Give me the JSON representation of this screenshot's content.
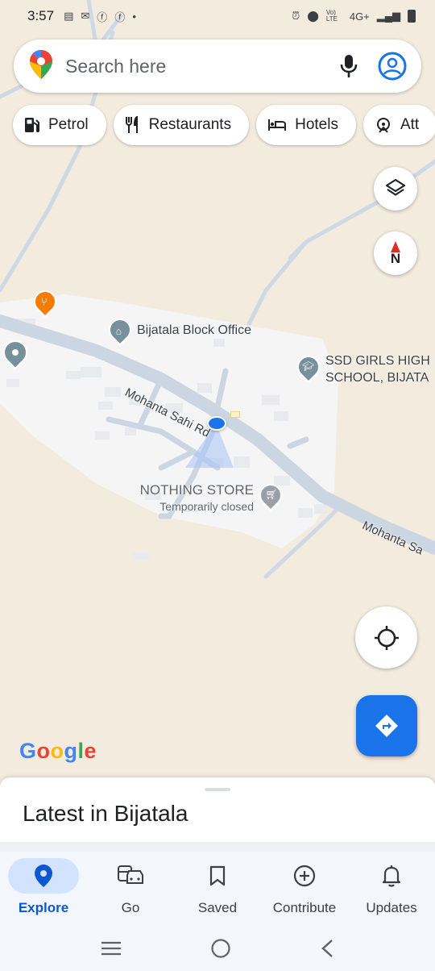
{
  "status_bar": {
    "time": "3:57",
    "network": "4G+",
    "volte": "Vo) LTE",
    "left_icons": [
      "news-icon",
      "chat-icon",
      "facebook-icon",
      "facebook-icon",
      "dot-icon"
    ],
    "right_icons": [
      "alarm-icon",
      "location-icon",
      "signal-icon",
      "battery-icon"
    ]
  },
  "search": {
    "placeholder": "Search here"
  },
  "chips": [
    {
      "label": "Petrol",
      "icon": "fuel-icon"
    },
    {
      "label": "Restaurants",
      "icon": "restaurant-icon"
    },
    {
      "label": "Hotels",
      "icon": "hotel-icon"
    },
    {
      "label": "Att",
      "icon": "attractions-icon"
    }
  ],
  "map": {
    "compass_label": "N",
    "places": {
      "block_office": "Bijatala Block Office",
      "school_line1": "SSD GIRLS HIGH",
      "school_line2": "SCHOOL, BIJATA",
      "store_name": "NOTHING STORE",
      "store_status": "Temporarily closed"
    },
    "roads": {
      "road1": "Mohanta Sahi Rd",
      "road2": "Mohanta Sa"
    },
    "logo_letters": [
      "G",
      "o",
      "o",
      "g",
      "l",
      "e"
    ]
  },
  "sheet": {
    "title": "Latest in Bijatala"
  },
  "nav": {
    "items": [
      {
        "label": "Explore",
        "active": true
      },
      {
        "label": "Go"
      },
      {
        "label": "Saved"
      },
      {
        "label": "Contribute"
      },
      {
        "label": "Updates"
      }
    ]
  },
  "colors": {
    "accent": "#1a73e8",
    "active_nav_bg": "#d3e3fd",
    "map_bg": "#f2ebde",
    "road": "#c9d5e3",
    "restaurant_pin": "#f57c00"
  }
}
